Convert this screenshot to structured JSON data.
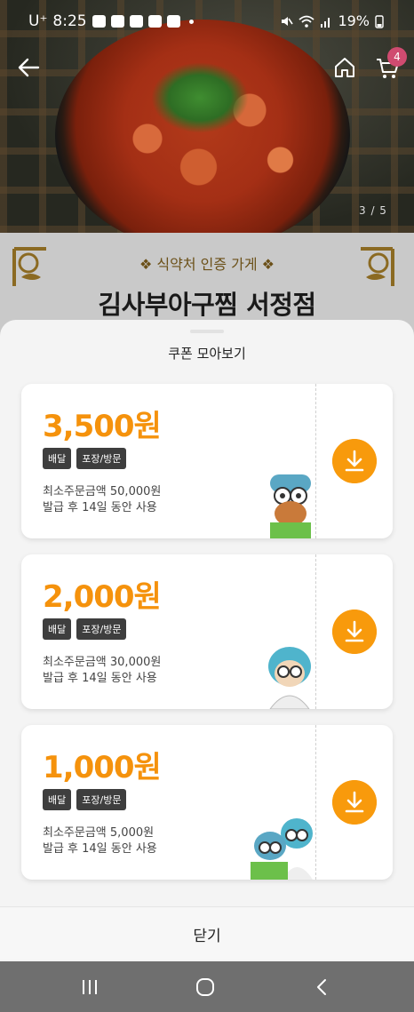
{
  "status": {
    "carrier": "U⁺",
    "time": "8:25",
    "battery": "19%"
  },
  "header": {
    "cart_count": "4",
    "page_indicator": "3 / 5"
  },
  "store": {
    "certification": "❖ 식약처 인증 가게 ❖",
    "name": "김사부아구찜 서정점"
  },
  "sheet": {
    "title": "쿠폰 모아보기",
    "close_label": "닫기"
  },
  "coupons": [
    {
      "amount": "3,500원",
      "tags": [
        "배달",
        "포장/방문"
      ],
      "min_order": "최소주문금액 50,000원",
      "validity": "발급 후 14일 동안 사용"
    },
    {
      "amount": "2,000원",
      "tags": [
        "배달",
        "포장/방문"
      ],
      "min_order": "최소주문금액 30,000원",
      "validity": "발급 후 14일 동안 사용"
    },
    {
      "amount": "1,000원",
      "tags": [
        "배달",
        "포장/방문"
      ],
      "min_order": "최소주문금액 5,000원",
      "validity": "발급 후 14일 동안 사용"
    }
  ],
  "colors": {
    "accent": "#f89a0c",
    "amount": "#f5920c",
    "tag_bg": "#3e3e3e",
    "badge": "#d04b70"
  },
  "icons": {
    "back": "arrow-left",
    "home": "house",
    "cart": "shopping-cart",
    "download": "download-arrow",
    "nav_recents": "three-bars",
    "nav_home": "rounded-square",
    "nav_back": "chevron-left"
  }
}
